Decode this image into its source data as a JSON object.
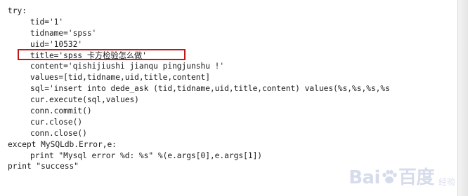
{
  "code": {
    "lines": [
      "try:",
      "tid='1'",
      "tidname='spss'",
      "uid='10532'",
      "title='spss 卡方检验怎么做'",
      "content='qishijiushi jianqu pingjunshu !'",
      "values=[tid,tidname,uid,title,content]",
      "sql='insert into dede_ask (tid,tidname,uid,title,content) values(%s,%s,%s,%s",
      "cur.execute(sql,values)",
      "conn.commit()",
      "cur.close()",
      "conn.close()",
      "except MySQLdb.Error,e:",
      "print \"Mysql error %d: %s\" %(e.args[0],e.args[1])",
      "print \"success\""
    ]
  },
  "watermark": {
    "logo_text": "Bai",
    "logo_text_2": "百度",
    "sub_text": "经验",
    "brand_color": "#cfd6e8"
  },
  "highlight": {
    "color": "#c0181b"
  }
}
